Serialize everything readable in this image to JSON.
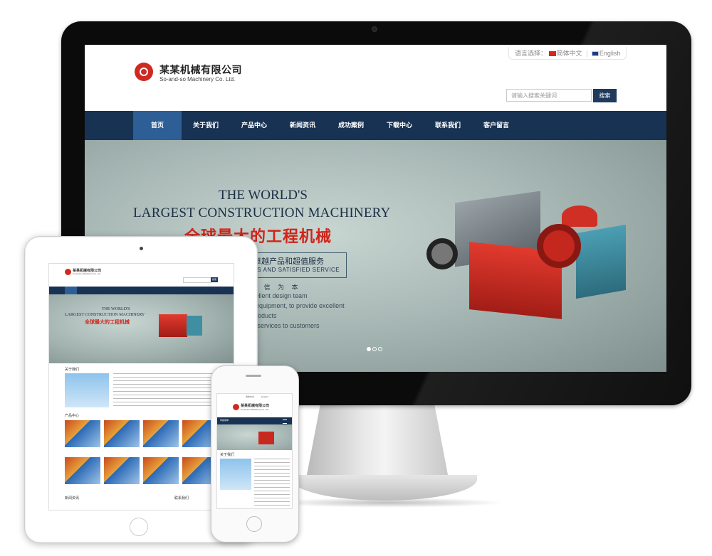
{
  "desktop": {
    "lang": {
      "label": "语言选择：",
      "cn": "简体中文",
      "sep": "|",
      "en": "English"
    },
    "brand": {
      "cn": "某某机械有限公司",
      "en": "So-and-so Machinery Co. Ltd."
    },
    "search": {
      "placeholder": "请输入搜索关键词",
      "button": "搜索"
    },
    "nav": [
      "首页",
      "关于我们",
      "产品中心",
      "新闻资讯",
      "成功案例",
      "下载中心",
      "联系我们",
      "客户留言"
    ],
    "hero": {
      "line1": "THE WORLD'S",
      "line2": "LARGEST CONSTRUCTION MACHINERY",
      "cn": "全球最大的工程机械",
      "box_cn": "卓越产品和超值服务",
      "box_en": "TS AND SATISFIED SERVICE",
      "motto": "诚  信  为  本",
      "lines": [
        "cellent design team",
        ", equipment, to provide excellent",
        "products",
        "d services to customers"
      ]
    }
  },
  "tablet": {
    "brand_cn": "某某机械有限公司",
    "brand_en": "So-and-so Machinery Co. Ltd.",
    "search_button": "搜索",
    "hero_line1": "THE WORLD'S",
    "hero_line2": "LARGEST CONSTRUCTION MACHINERY",
    "hero_cn": "全球最大的工程机械",
    "about_title": "关于我们",
    "products_title": "产品中心",
    "news_title": "新闻资讯",
    "contact_title": "联系我们"
  },
  "phone": {
    "brand_cn": "某某机械有限公司",
    "brand_en": "So-and-so Machinery Co. Ltd.",
    "lang_cn": "简体中文",
    "lang_en": "English",
    "nav_label": "导航菜单",
    "about_title": "关于我们"
  }
}
